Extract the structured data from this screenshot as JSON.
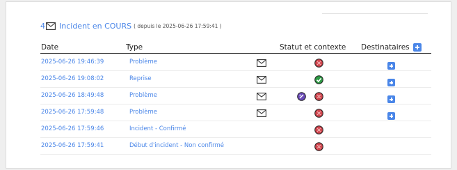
{
  "header": {
    "count": "4",
    "title": "Incident en COURS",
    "since": "( depuis le 2025-06-26 17:59:41 )"
  },
  "columns": {
    "date": "Date",
    "type": "Type",
    "statut": "Statut et contexte",
    "destinataires": "Destinataires"
  },
  "rows": [
    {
      "date": "2025-06-26 19:46:39",
      "type": "Problème",
      "mail": true,
      "status": "problem",
      "extra": null,
      "dest": true
    },
    {
      "date": "2025-06-26 19:08:02",
      "type": "Reprise",
      "mail": true,
      "status": "ok",
      "extra": null,
      "dest": true
    },
    {
      "date": "2025-06-26 18:49:48",
      "type": "Problème",
      "mail": true,
      "status": "problem",
      "extra": "context",
      "dest": true
    },
    {
      "date": "2025-06-26 17:59:48",
      "type": "Problème",
      "mail": true,
      "status": "problem",
      "extra": null,
      "dest": true
    },
    {
      "date": "2025-06-26 17:59:46",
      "type": "Incident - Confirmé",
      "mail": false,
      "status": "problem",
      "extra": null,
      "dest": false
    },
    {
      "date": "2025-06-26 17:59:41",
      "type": "Début d'incident - Non confirmé",
      "mail": false,
      "status": "problem",
      "extra": null,
      "dest": false
    }
  ],
  "icons": {
    "mail": "envelope-icon",
    "problem": "problem-status-icon",
    "ok": "ok-status-icon",
    "context": "context-icon",
    "add": "add-recipient-icon"
  },
  "colors": {
    "link": "#4a86e8",
    "problem": "#d0454d",
    "ok": "#2e9b45",
    "context": "#6a4ab8"
  }
}
